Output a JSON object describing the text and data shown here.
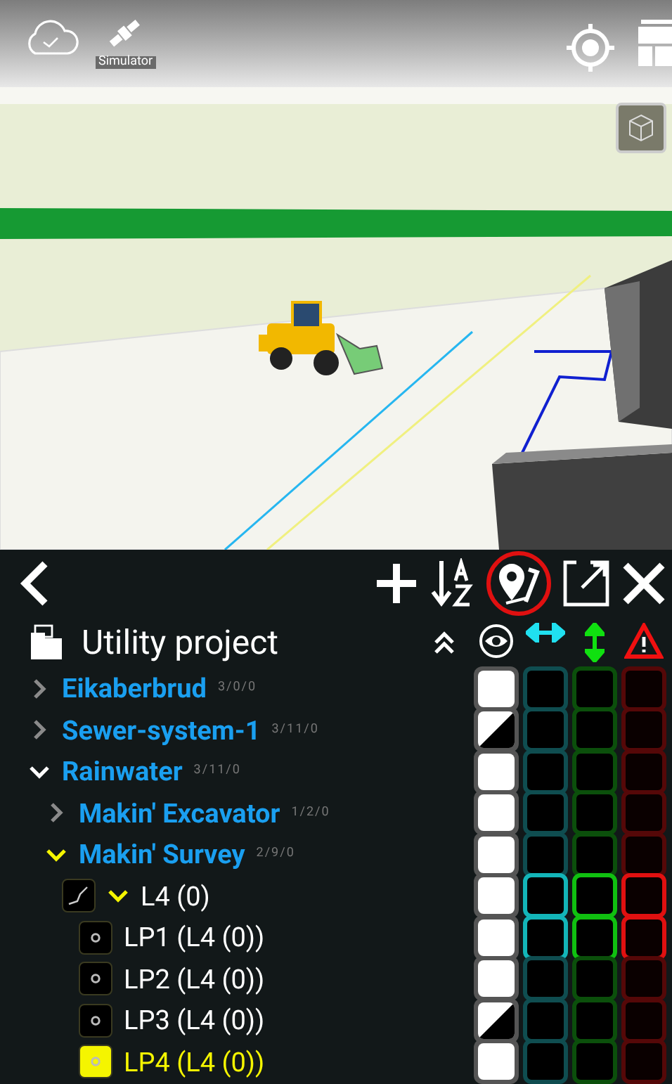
{
  "map": {
    "status_label": "Simulator"
  },
  "panel": {
    "title": "Utility project"
  },
  "tree": [
    {
      "name": "Eikaberbrud",
      "count": "3/0/0",
      "kind": "group",
      "expanded": false,
      "selected": false,
      "highlight": false,
      "partial": false,
      "active": false
    },
    {
      "name": "Sewer-system-1",
      "count": "3/11/0",
      "kind": "group",
      "expanded": false,
      "selected": false,
      "highlight": false,
      "partial": true,
      "active": false
    },
    {
      "name": "Rainwater",
      "count": "3/11/0",
      "kind": "group",
      "expanded": true,
      "selected": false,
      "highlight": false,
      "partial": false,
      "active": false,
      "children": [
        {
          "name": "Makin' Excavator",
          "count": "1/2/0",
          "kind": "group",
          "expanded": false,
          "selected": false,
          "highlight": false,
          "partial": false,
          "active": false
        },
        {
          "name": "Makin' Survey",
          "count": "2/9/0",
          "kind": "group",
          "expanded": true,
          "selected": false,
          "highlight": true,
          "partial": false,
          "active": false,
          "children": [
            {
              "name": "L4 (0)",
              "kind": "line",
              "expanded": true,
              "selected": false,
              "highlight": true,
              "partial": false,
              "active": true,
              "children": [
                {
                  "name": "LP1 (L4 (0))",
                  "kind": "point",
                  "selected": false,
                  "partial": false,
                  "active": true
                },
                {
                  "name": "LP2 (L4 (0))",
                  "kind": "point",
                  "selected": false,
                  "partial": false,
                  "active": false
                },
                {
                  "name": "LP3 (L4 (0))",
                  "kind": "point",
                  "selected": false,
                  "partial": true,
                  "active": false
                },
                {
                  "name": "LP4 (L4 (0))",
                  "kind": "point",
                  "selected": true,
                  "partial": false,
                  "active": false
                }
              ]
            }
          ]
        }
      ]
    }
  ]
}
